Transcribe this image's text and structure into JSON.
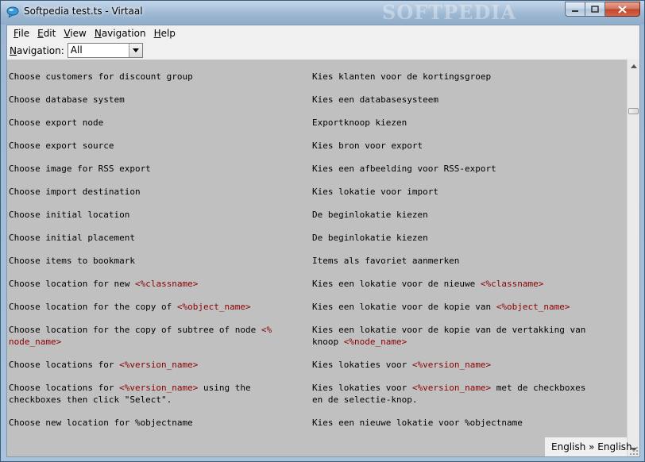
{
  "window": {
    "title": "Softpedia test.ts - Virtaal",
    "watermark": "SOFTPEDIA",
    "buttons": {
      "minimize": "–",
      "maximize": "□",
      "close": "X"
    }
  },
  "menu": [
    {
      "accel": "F",
      "rest": "ile"
    },
    {
      "accel": "E",
      "rest": "dit"
    },
    {
      "accel": "V",
      "rest": "iew"
    },
    {
      "accel": "N",
      "rest": "avigation"
    },
    {
      "accel": "H",
      "rest": "elp"
    }
  ],
  "navigation": {
    "label_accel": "N",
    "label_rest": "avigation:",
    "selected": "All"
  },
  "rows": [
    {
      "src": [
        {
          "t": "Choose customers for discount group"
        }
      ],
      "tgt": [
        {
          "t": "Kies klanten voor de kortingsgroep"
        }
      ]
    },
    {
      "src": [
        {
          "t": "Choose database system"
        }
      ],
      "tgt": [
        {
          "t": "Kies een databasesysteem"
        }
      ]
    },
    {
      "src": [
        {
          "t": "Choose export node"
        }
      ],
      "tgt": [
        {
          "t": "Exportknoop kiezen"
        }
      ]
    },
    {
      "src": [
        {
          "t": "Choose export source"
        }
      ],
      "tgt": [
        {
          "t": "Kies bron voor export"
        }
      ]
    },
    {
      "src": [
        {
          "t": "Choose image for RSS export"
        }
      ],
      "tgt": [
        {
          "t": "Kies een afbeelding voor RSS-export"
        }
      ]
    },
    {
      "src": [
        {
          "t": "Choose import destination"
        }
      ],
      "tgt": [
        {
          "t": "Kies lokatie voor import"
        }
      ]
    },
    {
      "src": [
        {
          "t": "Choose initial location"
        }
      ],
      "tgt": [
        {
          "t": "De beginlokatie kiezen"
        }
      ]
    },
    {
      "src": [
        {
          "t": "Choose initial placement"
        }
      ],
      "tgt": [
        {
          "t": "De beginlokatie kiezen"
        }
      ]
    },
    {
      "src": [
        {
          "t": "Choose items to bookmark"
        }
      ],
      "tgt": [
        {
          "t": "Items als favoriet aanmerken"
        }
      ]
    },
    {
      "src": [
        {
          "t": "Choose location for new "
        },
        {
          "t": "<%classname>",
          "ph": true
        }
      ],
      "tgt": [
        {
          "t": "Kies een lokatie voor de nieuwe "
        },
        {
          "t": "<%classname>",
          "ph": true
        }
      ]
    },
    {
      "src": [
        {
          "t": "Choose location for the copy of "
        },
        {
          "t": "<%object_name>",
          "ph": true
        }
      ],
      "tgt": [
        {
          "t": "Kies een lokatie voor de kopie van "
        },
        {
          "t": "<%object_name>",
          "ph": true
        }
      ]
    },
    {
      "src": [
        {
          "t": "Choose location for the copy of subtree of node "
        },
        {
          "t": "<%\nnode_name>",
          "ph": true
        }
      ],
      "tgt": [
        {
          "t": "Kies een lokatie voor de kopie van de vertakking van\nknoop "
        },
        {
          "t": "<%node_name>",
          "ph": true
        }
      ]
    },
    {
      "src": [
        {
          "t": "Choose locations for "
        },
        {
          "t": "<%version_name>",
          "ph": true
        }
      ],
      "tgt": [
        {
          "t": "Kies lokaties voor "
        },
        {
          "t": "<%version_name>",
          "ph": true
        }
      ]
    },
    {
      "src": [
        {
          "t": "Choose locations for "
        },
        {
          "t": "<%version_name>",
          "ph": true
        },
        {
          "t": " using the\ncheckboxes then click \"Select\"."
        }
      ],
      "tgt": [
        {
          "t": "Kies lokaties voor "
        },
        {
          "t": "<%version_name>",
          "ph": true
        },
        {
          "t": " met de checkboxes\nen de selectie-knop."
        }
      ]
    },
    {
      "src": [
        {
          "t": "Choose new location for %objectname"
        }
      ],
      "tgt": [
        {
          "t": "Kies een nieuwe lokatie voor %objectname"
        }
      ]
    }
  ],
  "status": {
    "language_pair": "English » English"
  },
  "scrollbar": {
    "position_fraction": 0.12
  }
}
